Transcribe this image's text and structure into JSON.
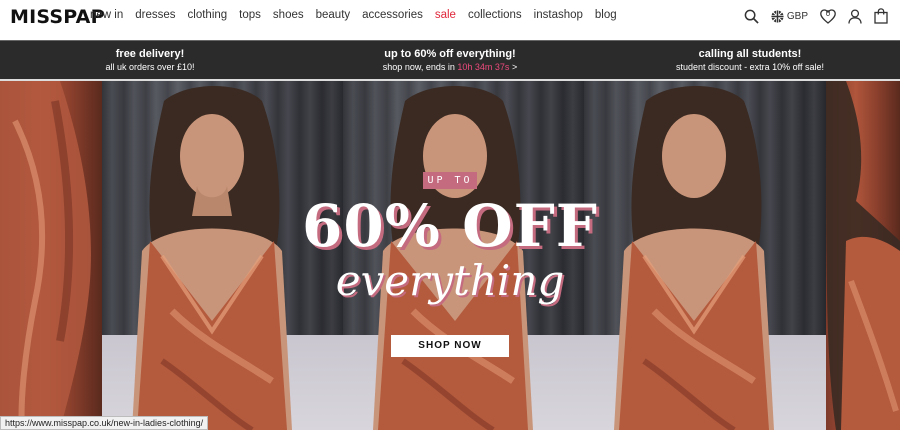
{
  "header": {
    "logo": "MISSPAP",
    "nav": [
      {
        "label": "new in",
        "key": "new-in"
      },
      {
        "label": "dresses",
        "key": "dresses"
      },
      {
        "label": "clothing",
        "key": "clothing"
      },
      {
        "label": "tops",
        "key": "tops"
      },
      {
        "label": "shoes",
        "key": "shoes"
      },
      {
        "label": "beauty",
        "key": "beauty"
      },
      {
        "label": "accessories",
        "key": "accessories"
      },
      {
        "label": "sale",
        "key": "sale"
      },
      {
        "label": "collections",
        "key": "collections"
      },
      {
        "label": "instashop",
        "key": "instashop"
      },
      {
        "label": "blog",
        "key": "blog"
      }
    ],
    "currency": "GBP",
    "wishlist_count": "0",
    "icons": [
      "search-icon",
      "uk-flag-icon",
      "heart-icon",
      "account-icon",
      "shopping-bag-icon"
    ],
    "sale_color": "#e0283c"
  },
  "promo": {
    "delivery_title": "free delivery!",
    "delivery_sub": "all uk orders over £10!",
    "sale_title": "up to 60% off everything!",
    "sale_sub_prefix": "shop now, ends in",
    "sale_timer": "10h 34m 37s",
    "sale_sub_suffix": ">",
    "students_title": "calling all students!",
    "students_sub": "student discount - extra 10% off sale!",
    "background": "#2b2b2b",
    "timer_color": "#ee4a7d"
  },
  "hero": {
    "tag": "UP TO",
    "headline": "60% OFF",
    "subheadline": "everything",
    "button": "SHOP NOW",
    "accent": "#c46b80"
  },
  "status_url": "https://www.misspap.co.uk/new-in-ladies-clothing/"
}
